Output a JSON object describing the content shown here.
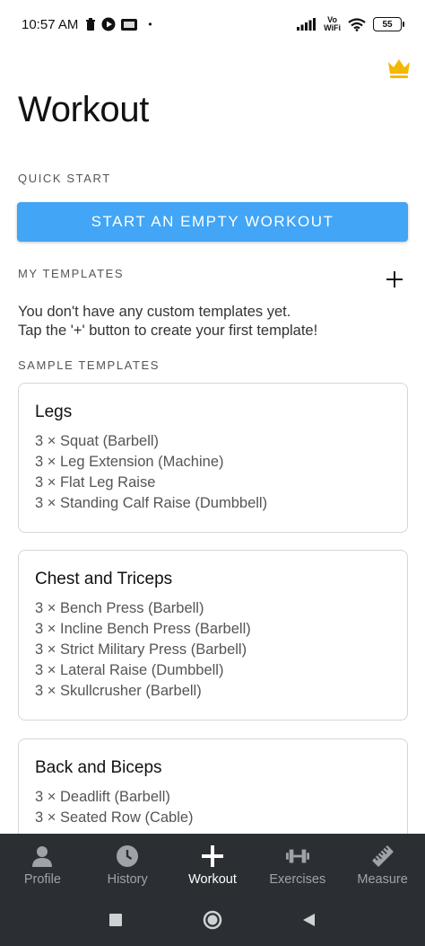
{
  "status_bar": {
    "time": "10:57 AM",
    "vowifi_top": "Vo",
    "vowifi_bottom": "WiFi",
    "battery": "55",
    "dot": "•"
  },
  "header": {
    "title": "Workout",
    "premium_icon": "crown-icon",
    "accent_color": "#f5b800"
  },
  "quick_start": {
    "label": "QUICK START",
    "button_label": "START AN EMPTY WORKOUT",
    "button_color": "#42a5f5"
  },
  "my_templates": {
    "label": "MY TEMPLATES",
    "add_icon": "plus-icon",
    "empty_line1": "You don't have any custom templates yet.",
    "empty_line2": "Tap the '+' button to create your first template!"
  },
  "sample_templates": {
    "label": "SAMPLE TEMPLATES",
    "cards": [
      {
        "title": "Legs",
        "exercises": [
          "3 × Squat (Barbell)",
          "3 × Leg Extension (Machine)",
          "3 × Flat Leg Raise",
          "3 × Standing Calf Raise (Dumbbell)"
        ]
      },
      {
        "title": "Chest and Triceps",
        "exercises": [
          "3 × Bench Press (Barbell)",
          "3 × Incline Bench Press (Barbell)",
          "3 × Strict Military Press (Barbell)",
          "3 × Lateral Raise (Dumbbell)",
          "3 × Skullcrusher (Barbell)"
        ]
      },
      {
        "title": "Back and Biceps",
        "exercises": [
          "3 × Deadlift (Barbell)",
          "3 × Seated Row (Cable)"
        ]
      }
    ]
  },
  "bottom_nav": {
    "items": [
      {
        "label": "Profile",
        "icon": "person-icon",
        "active": false
      },
      {
        "label": "History",
        "icon": "clock-icon",
        "active": false
      },
      {
        "label": "Workout",
        "icon": "plus-icon",
        "active": true
      },
      {
        "label": "Exercises",
        "icon": "dumbbell-icon",
        "active": false
      },
      {
        "label": "Measure",
        "icon": "ruler-icon",
        "active": false
      }
    ],
    "background": "#2b2f34"
  },
  "system_nav": {
    "items": [
      "square-icon",
      "circle-icon",
      "back-triangle-icon"
    ]
  }
}
